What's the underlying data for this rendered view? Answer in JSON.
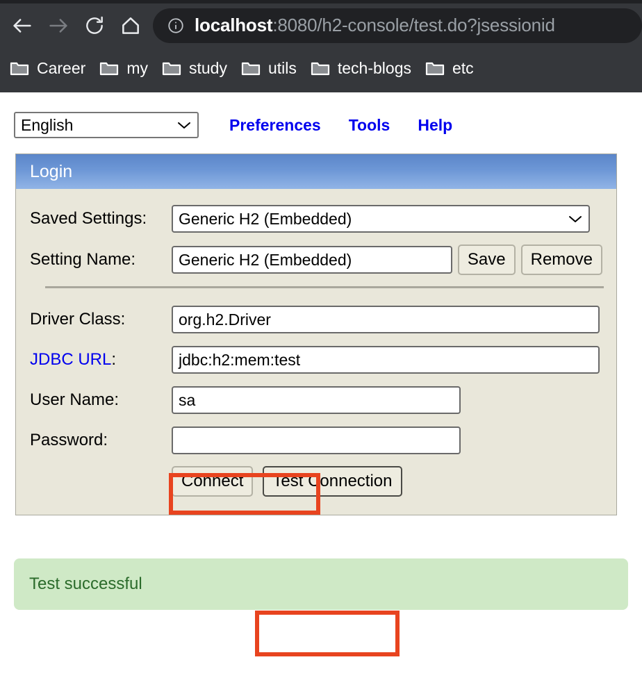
{
  "browser": {
    "nav": [
      {
        "name": "back-button",
        "icon": "arrow-left-icon",
        "state": "enabled"
      },
      {
        "name": "forward-button",
        "icon": "arrow-right-icon",
        "state": "disabled"
      },
      {
        "name": "reload-button",
        "icon": "reload-icon",
        "state": "enabled"
      },
      {
        "name": "home-button",
        "icon": "home-icon",
        "state": "enabled"
      }
    ],
    "omnibox": {
      "icon": "info-circle-icon",
      "host": "localhost",
      "rest": ":8080/h2-console/test.do?jsessionid",
      "full_url": "localhost:8080/h2-console/test.do?jsessionid"
    },
    "bookmarks": [
      {
        "label": "Career",
        "icon": "folder-icon"
      },
      {
        "label": "my",
        "icon": "folder-icon"
      },
      {
        "label": "study",
        "icon": "folder-icon"
      },
      {
        "label": "utils",
        "icon": "folder-icon"
      },
      {
        "label": "tech-blogs",
        "icon": "folder-icon"
      },
      {
        "label": "etc",
        "icon": "folder-icon"
      }
    ]
  },
  "toolbar": {
    "language_selected": "English",
    "language_options": [
      "English"
    ],
    "links": [
      {
        "label": "Preferences"
      },
      {
        "label": "Tools"
      },
      {
        "label": "Help"
      }
    ]
  },
  "login_panel": {
    "title": "Login",
    "fields": {
      "saved_settings_label": "Saved Settings:",
      "saved_settings_value": "Generic H2 (Embedded)",
      "setting_name_label": "Setting Name:",
      "setting_name_value": "Generic H2 (Embedded)",
      "save_button": "Save",
      "remove_button": "Remove",
      "driver_class_label": "Driver Class:",
      "driver_class_value": "org.h2.Driver",
      "jdbc_url_label": "JDBC URL",
      "jdbc_url_label_colon": ":",
      "jdbc_url_value": "jdbc:h2:mem:test",
      "user_name_label": "User Name:",
      "user_name_value": "sa",
      "password_label": "Password:",
      "password_value": ""
    },
    "buttons": {
      "connect": "Connect",
      "test_connection": "Test Connection"
    }
  },
  "status": {
    "message": "Test successful"
  },
  "colors": {
    "highlight": "#e8441f",
    "panel_header_blue": "#6d97d6",
    "panel_bg": "#e9e7da",
    "link_blue": "#0000ee",
    "success_bg": "#cfe9c6",
    "success_text": "#2b6b2b",
    "chrome_bg": "#35373b"
  }
}
